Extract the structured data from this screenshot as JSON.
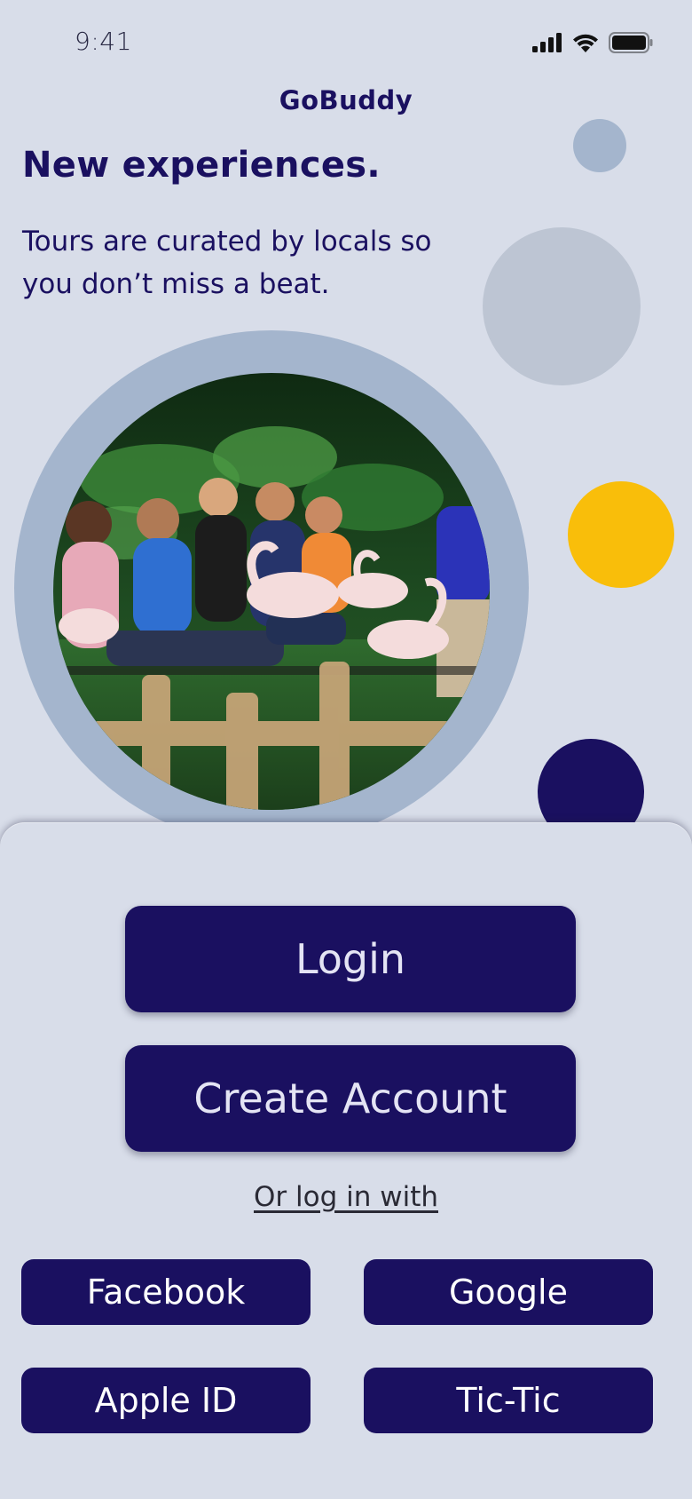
{
  "status_bar": {
    "time": "9:41",
    "icons": [
      "cellular-signal-icon",
      "wifi-icon",
      "battery-icon"
    ]
  },
  "app": {
    "title": "GoBuddy"
  },
  "hero": {
    "headline": "New experiences.",
    "tagline": "Tours are curated by locals so you don’t miss a beat."
  },
  "auth": {
    "login_label": "Login",
    "create_account_label": "Create Account",
    "alt_login_prompt": "Or log in with",
    "providers": [
      {
        "label": "Facebook"
      },
      {
        "label": "Google"
      },
      {
        "label": "Apple ID"
      },
      {
        "label": "Tic-Tic"
      }
    ]
  },
  "colors": {
    "background": "#d8dde9",
    "primary": "#1a1060",
    "accent_yellow": "#f9be0a",
    "ring_blue": "#a4b5cd",
    "soft_gray": "#bdc5d3",
    "text_on_primary": "#e4e4f4"
  }
}
